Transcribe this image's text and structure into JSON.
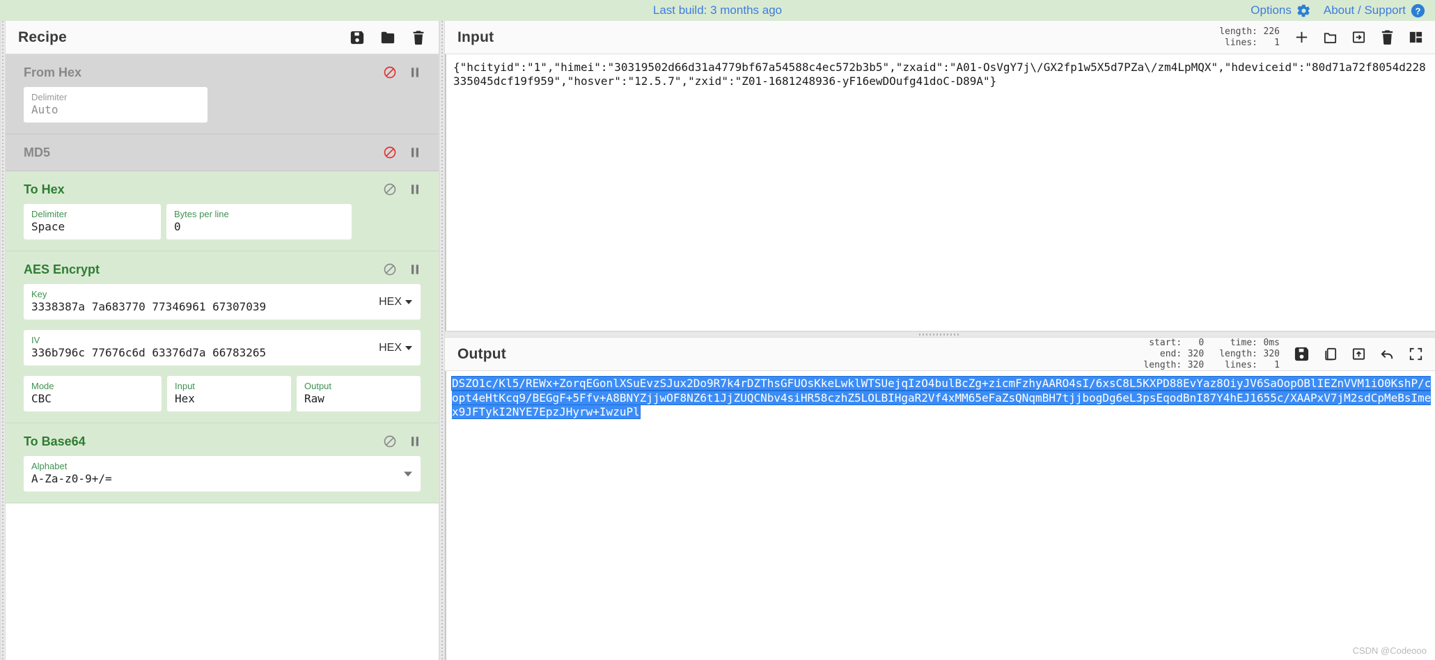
{
  "banner": {
    "build_text": "Last build: 3 months ago",
    "options_label": "Options",
    "about_label": "About / Support",
    "link_color": "#3d7ddd",
    "background": "#d9ead3"
  },
  "recipe": {
    "title": "Recipe",
    "icons": [
      "save-icon",
      "folder-icon",
      "trash-icon"
    ],
    "operations": [
      {
        "name": "From Hex",
        "enabled": false,
        "args": [
          {
            "label": "Delimiter",
            "value": "Auto",
            "type": "text"
          }
        ]
      },
      {
        "name": "MD5",
        "enabled": false,
        "args": []
      },
      {
        "name": "To Hex",
        "enabled": true,
        "args": [
          {
            "label": "Delimiter",
            "value": "Space",
            "type": "text"
          },
          {
            "label": "Bytes per line",
            "value": "0",
            "type": "text"
          }
        ]
      },
      {
        "name": "AES Encrypt",
        "enabled": true,
        "args": [
          {
            "label": "Key",
            "value": "3338387a 7a683770 77346961 67307039",
            "type": "text",
            "suffix": "HEX"
          },
          {
            "label": "IV",
            "value": "336b796c 77676c6d 63376d7a 66783265",
            "type": "text",
            "suffix": "HEX"
          },
          {
            "label": "Mode",
            "value": "CBC",
            "type": "select"
          },
          {
            "label": "Input",
            "value": "Hex",
            "type": "select"
          },
          {
            "label": "Output",
            "value": "Raw",
            "type": "select"
          }
        ]
      },
      {
        "name": "To Base64",
        "enabled": true,
        "args": [
          {
            "label": "Alphabet",
            "value": "A-Za-z0-9+/=",
            "type": "select"
          }
        ]
      }
    ]
  },
  "input": {
    "title": "Input",
    "meta": {
      "length_label": "length:",
      "length_value": "226",
      "lines_label": "lines:",
      "lines_value": "1"
    },
    "icons": [
      "add-tab-icon",
      "open-folder-icon",
      "open-file-icon",
      "clear-icon",
      "tabs-icon"
    ],
    "text": "{\"hcityid\":\"1\",\"himei\":\"30319502d66d31a4779bf67a54588c4ec572b3b5\",\"zxaid\":\"A01-OsVgY7j\\/GX2fp1w5X5d7PZa\\/zm4LpMQX\",\"hdeviceid\":\"80d71a72f8054d228335045dcf19f959\",\"hosver\":\"12.5.7\",\"zxid\":\"Z01-1681248936-yF16ewDOufg41doC-D89A\"}"
  },
  "output": {
    "title": "Output",
    "meta": {
      "start_label": "start:",
      "start_value": "0",
      "end_label": "end:",
      "end_value": "320",
      "length_label": "length:",
      "length_value": "320",
      "time_label": "time:",
      "time_value": "0ms",
      "out_length_label": "length:",
      "out_length_value": "320",
      "lines_label": "lines:",
      "lines_value": "1"
    },
    "icons": [
      "save-icon",
      "copy-icon",
      "replace-input-icon",
      "undo-icon",
      "maximise-icon"
    ],
    "text": "DSZO1c/Kl5/REWx+ZorqEGonlXSuEvzSJux2Do9R7k4rDZThsGFUOsKkeLwklWTSUejqIzO4bulBcZg+zicmFzhyAARO4sI/6xsC8L5KXPD88EvYaz8OiyJV6SaOopOBlIEZnVVM1iO0KshP/copt4eHtKcq9/BEGgF+5Ffv+A8BNYZjjwOF8NZ6t1JjZUQCNbv4siHR58czhZ5LOLBIHgaR2Vf4xMM65eFaZsQNqmBH7tjjbogDg6eL3psEqodBnI87Y4hEJ1655c/XAAPxV7jM2sdCpMeBsImex9JFTykI2NYE7EpzJHyrw+IwzuPl",
    "selected": true,
    "selection_color": "#3b8cf7"
  },
  "watermark": "CSDN @Codeooo"
}
